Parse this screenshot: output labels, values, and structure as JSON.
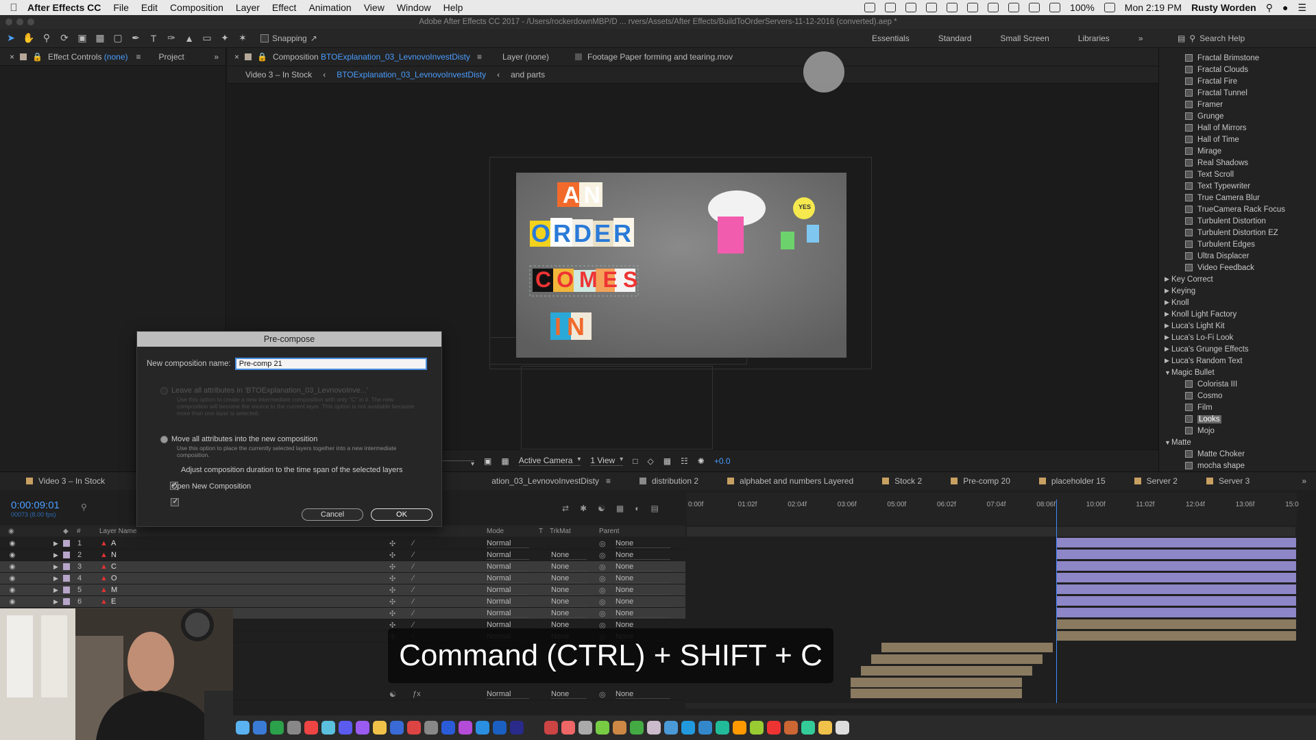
{
  "menubar": {
    "app": "After Effects CC",
    "items": [
      "File",
      "Edit",
      "Composition",
      "Layer",
      "Effect",
      "Animation",
      "View",
      "Window",
      "Help"
    ],
    "battery": "100%",
    "clock": "Mon 2:19 PM",
    "user": "Rusty Worden"
  },
  "window_title": "Adobe After Effects CC 2017 - /Users/rockerdownMBP/D ... rvers/Assets/After Effects/BuildToOrderServers-11-12-2016 (converted).aep *",
  "toolbar": {
    "snapping": "Snapping",
    "workspaces": [
      "Essentials",
      "Standard",
      "Small Screen",
      "Libraries"
    ],
    "search": "Search Help"
  },
  "left_panel": {
    "tab_effect_controls": "Effect Controls",
    "tab_effect_controls_target": "(none)",
    "tab_project": "Project"
  },
  "comp_panel": {
    "tab_prefix": "Composition",
    "tab_comp": "BTOExplanation_03_LevnovoInvestDisty",
    "tab_layer": "Layer (none)",
    "tab_footage": "Footage Paper forming and tearing.mov",
    "breadcrumb": [
      "Video 3 – In Stock",
      "BTOExplanation_03_LevnovoInvestDisty",
      "and parts"
    ],
    "viewer": {
      "camera": "Active Camera",
      "views": "1 View",
      "exposure": "+0.0",
      "art_words": [
        "AN",
        "ORDER",
        "COMES",
        "IN"
      ],
      "sticker_text": "YES"
    }
  },
  "effects_panel": {
    "items": [
      {
        "label": "Fractal Brimstone",
        "kind": "child"
      },
      {
        "label": "Fractal Clouds",
        "kind": "child"
      },
      {
        "label": "Fractal Fire",
        "kind": "child"
      },
      {
        "label": "Fractal Tunnel",
        "kind": "child"
      },
      {
        "label": "Framer",
        "kind": "child"
      },
      {
        "label": "Grunge",
        "kind": "child"
      },
      {
        "label": "Hall of Mirrors",
        "kind": "child"
      },
      {
        "label": "Hall of Time",
        "kind": "child"
      },
      {
        "label": "Mirage",
        "kind": "child"
      },
      {
        "label": "Real Shadows",
        "kind": "child"
      },
      {
        "label": "Text Scroll",
        "kind": "child"
      },
      {
        "label": "Text Typewriter",
        "kind": "child"
      },
      {
        "label": "True Camera Blur",
        "kind": "child"
      },
      {
        "label": "TrueCamera Rack Focus",
        "kind": "child"
      },
      {
        "label": "Turbulent Distortion",
        "kind": "child"
      },
      {
        "label": "Turbulent Distortion EZ",
        "kind": "child"
      },
      {
        "label": "Turbulent Edges",
        "kind": "child"
      },
      {
        "label": "Ultra Displacer",
        "kind": "child"
      },
      {
        "label": "Video Feedback",
        "kind": "child"
      },
      {
        "label": "Key Correct",
        "kind": "cat"
      },
      {
        "label": "Keying",
        "kind": "cat"
      },
      {
        "label": "Knoll",
        "kind": "cat"
      },
      {
        "label": "Knoll Light Factory",
        "kind": "cat"
      },
      {
        "label": "Luca's Light Kit",
        "kind": "cat"
      },
      {
        "label": "Luca's Lo-Fi Look",
        "kind": "cat"
      },
      {
        "label": "Luca's Grunge Effects",
        "kind": "cat"
      },
      {
        "label": "Luca's Random Text",
        "kind": "cat"
      },
      {
        "label": "Magic Bullet",
        "kind": "open"
      },
      {
        "label": "Colorista III",
        "kind": "child"
      },
      {
        "label": "Cosmo",
        "kind": "child"
      },
      {
        "label": "Film",
        "kind": "child"
      },
      {
        "label": "Looks",
        "kind": "child",
        "selected": true
      },
      {
        "label": "Mojo",
        "kind": "child"
      },
      {
        "label": "Matte",
        "kind": "open"
      },
      {
        "label": "Matte Choker",
        "kind": "child"
      },
      {
        "label": "mocha shape",
        "kind": "child"
      }
    ]
  },
  "timeline": {
    "tabs": [
      "Video 3 – In Stock",
      "ation_03_LevnovoInvestDisty",
      "distribution 2",
      "alphabet and numbers Layered",
      "Stock 2",
      "Pre-comp 20",
      "placeholder 15",
      "Server 2",
      "Server 3"
    ],
    "timecode": "0:00:09:01",
    "fps": "00073 (8.00 fps)",
    "columns": {
      "layer_name": "Layer Name",
      "mode": "Mode",
      "t": "T",
      "trkmat": "TrkMat",
      "parent": "Parent"
    },
    "ruler": [
      "0:00f",
      "01:02f",
      "02:04f",
      "03:06f",
      "05:00f",
      "06:02f",
      "07:04f",
      "08:06f",
      "10:00f",
      "11:02f",
      "12:04f",
      "13:06f",
      "15:0"
    ],
    "layers": [
      {
        "num": "1",
        "name": "A",
        "mode": "Normal",
        "trk": "",
        "parent": "None",
        "selected": false
      },
      {
        "num": "2",
        "name": "N",
        "mode": "Normal",
        "trk": "None",
        "parent": "None",
        "selected": false
      },
      {
        "num": "3",
        "name": "C",
        "mode": "Normal",
        "trk": "None",
        "parent": "None",
        "selected": true
      },
      {
        "num": "4",
        "name": "O",
        "mode": "Normal",
        "trk": "None",
        "parent": "None",
        "selected": true
      },
      {
        "num": "5",
        "name": "M",
        "mode": "Normal",
        "trk": "None",
        "parent": "None",
        "selected": true
      },
      {
        "num": "6",
        "name": "E",
        "mode": "Normal",
        "trk": "None",
        "parent": "None",
        "selected": true
      },
      {
        "num": "7",
        "name": "",
        "mode": "Normal",
        "trk": "None",
        "parent": "None",
        "selected": true
      },
      {
        "num": "",
        "name": "",
        "mode": "Normal",
        "trk": "None",
        "parent": "None",
        "selected": false
      },
      {
        "num": "",
        "name": "",
        "mode": "Normal",
        "trk": "None",
        "parent": "None",
        "selected": false
      }
    ],
    "last_row": {
      "mode": "Normal",
      "trk": "None",
      "parent": "None"
    }
  },
  "dialog": {
    "title": "Pre-compose",
    "name_label": "New composition name:",
    "name_value": "Pre-comp 21",
    "opt_leave": "Leave all attributes in 'BTOExplanation_03_LevnovoInve...'",
    "opt_leave_note": "Use this option to create a new intermediate composition with only \"C\" in it. The new composition will become the source to the current layer. This option is not available because more than one layer is selected.",
    "opt_move": "Move all attributes into the new composition",
    "opt_move_note": "Use this option to place the currently selected layers together into a new intermediate composition.",
    "opt_adjust": "Adjust composition duration to the time span of the selected layers",
    "opt_open": "Open New Composition",
    "cancel": "Cancel",
    "ok": "OK"
  },
  "caption": "Command (CTRL) + SHIFT + C"
}
